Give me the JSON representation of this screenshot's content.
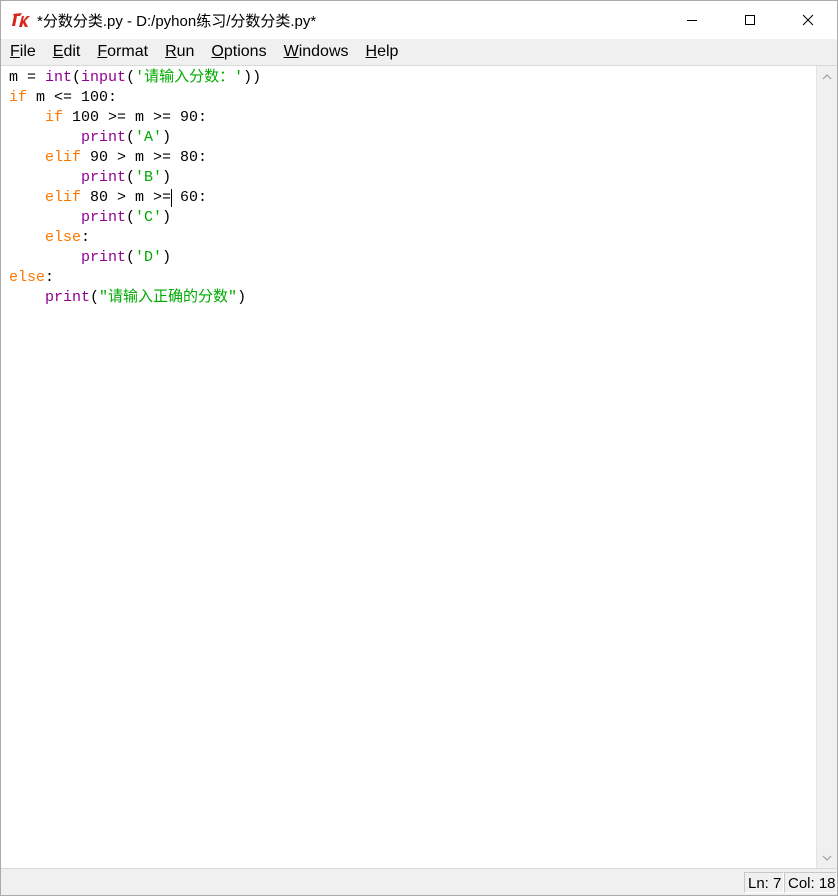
{
  "window": {
    "title": "*分数分类.py - D:/pyhon练习/分数分类.py*",
    "controls": [
      "minimize",
      "maximize",
      "close"
    ]
  },
  "menu": {
    "items": [
      "File",
      "Edit",
      "Format",
      "Run",
      "Options",
      "Windows",
      "Help"
    ]
  },
  "code": {
    "lines": [
      [
        {
          "t": "m = ",
          "c": ""
        },
        {
          "t": "int",
          "c": "bi"
        },
        {
          "t": "(",
          "c": ""
        },
        {
          "t": "input",
          "c": "bi"
        },
        {
          "t": "(",
          "c": ""
        },
        {
          "t": "'请输入分数：'",
          "c": "st"
        },
        {
          "t": "))",
          "c": ""
        }
      ],
      [
        {
          "t": "if",
          "c": "kw"
        },
        {
          "t": " m <= 100:",
          "c": ""
        }
      ],
      [
        {
          "t": "    ",
          "c": ""
        },
        {
          "t": "if",
          "c": "kw"
        },
        {
          "t": " 100 >= m >= 90:",
          "c": ""
        }
      ],
      [
        {
          "t": "        ",
          "c": ""
        },
        {
          "t": "print",
          "c": "bi"
        },
        {
          "t": "(",
          "c": ""
        },
        {
          "t": "'A'",
          "c": "st"
        },
        {
          "t": ")",
          "c": ""
        }
      ],
      [
        {
          "t": "    ",
          "c": ""
        },
        {
          "t": "elif",
          "c": "kw"
        },
        {
          "t": " 90 > m >= 80:",
          "c": ""
        }
      ],
      [
        {
          "t": "        ",
          "c": ""
        },
        {
          "t": "print",
          "c": "bi"
        },
        {
          "t": "(",
          "c": ""
        },
        {
          "t": "'B'",
          "c": "st"
        },
        {
          "t": ")",
          "c": ""
        }
      ],
      [
        {
          "t": "    ",
          "c": ""
        },
        {
          "t": "elif",
          "c": "kw"
        },
        {
          "t": " 80 > m >= 60:",
          "c": ""
        }
      ],
      [
        {
          "t": "        ",
          "c": ""
        },
        {
          "t": "print",
          "c": "bi"
        },
        {
          "t": "(",
          "c": ""
        },
        {
          "t": "'C'",
          "c": "st"
        },
        {
          "t": ")",
          "c": ""
        }
      ],
      [
        {
          "t": "    ",
          "c": ""
        },
        {
          "t": "else",
          "c": "kw"
        },
        {
          "t": ":",
          "c": ""
        }
      ],
      [
        {
          "t": "        ",
          "c": ""
        },
        {
          "t": "print",
          "c": "bi"
        },
        {
          "t": "(",
          "c": ""
        },
        {
          "t": "'D'",
          "c": "st"
        },
        {
          "t": ")",
          "c": ""
        }
      ],
      [
        {
          "t": "else",
          "c": "kw"
        },
        {
          "t": ":",
          "c": ""
        }
      ],
      [
        {
          "t": "    ",
          "c": ""
        },
        {
          "t": "print",
          "c": "bi"
        },
        {
          "t": "(",
          "c": ""
        },
        {
          "t": "\"请输入正确的分数\"",
          "c": "st"
        },
        {
          "t": ")",
          "c": ""
        }
      ]
    ]
  },
  "status": {
    "line": "Ln: 7",
    "col": "Col: 18"
  },
  "colors": {
    "keyword": "#ff7700",
    "builtin": "#900090",
    "string": "#00aa00",
    "icon_red": "#d6261c"
  },
  "icons": {
    "app": "tk-feather-icon",
    "minimize": "minimize-icon",
    "maximize": "maximize-icon",
    "close": "close-icon",
    "scroll_up": "scroll-up-arrow-icon",
    "scroll_down": "scroll-down-arrow-icon"
  }
}
